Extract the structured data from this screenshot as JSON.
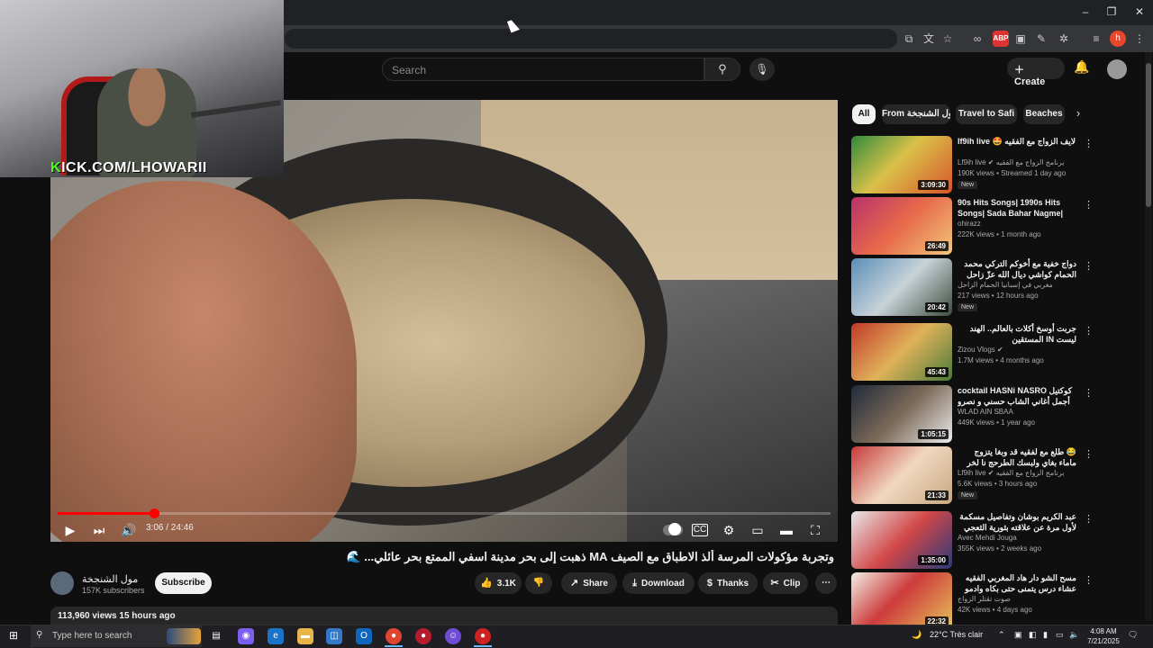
{
  "youtube": {
    "search_placeholder": "Search",
    "create_label": "Create"
  },
  "webcam": {
    "overlay_text_prefix": "K",
    "overlay_text": "KICK.COM/LHOWARII"
  },
  "player": {
    "time": "3:06 / 24:46",
    "progress": 0.125
  },
  "video": {
    "title": "وتجربة مؤكولات المرسة ألذ الاطباق مع الصيف MA ذهبت إلى بحر مدينة اسفي الممتع بحر عائلي... 🌊",
    "channel_name": "مول الشنجخة",
    "subscribers": "157K subscribers",
    "subscribe_label": "Subscribe",
    "likes": "3.1K",
    "share_label": "Share",
    "download_label": "Download",
    "thanks_label": "Thanks",
    "clip_label": "Clip",
    "views_date": "113,960 views  15 hours ago"
  },
  "chips": [
    {
      "label": "All"
    },
    {
      "label": "From مول الشنجخة"
    },
    {
      "label": "Travel to Safi"
    },
    {
      "label": "Beaches"
    }
  ],
  "sidebar": [
    {
      "title": "lf9ih live 🤩 لايف الزواج مع الفقيه",
      "channel": "Lf9ih live ✔ برنامج الزواج مع الفقيه",
      "meta": "190K views • Streamed 1 day ago",
      "badge": "New",
      "duration": "3:09:30",
      "rtl": false
    },
    {
      "title": "90s Hits Songs| 1990s Hits Songs| Sada Bahar Nagme| Sr...",
      "channel": "ohirazz",
      "meta": "222K views • 1 month ago",
      "badge": "",
      "duration": "26:49",
      "rtl": false
    },
    {
      "title": "دواج خفية مع أخوكم التركي محمد الحمام كواشي ديال الله عزّ زاحل في إسبانيا 😂 ...",
      "channel": "مغربي في إسبانيا الحمام الزاحل",
      "meta": "217 views • 12 hours ago",
      "badge": "New",
      "duration": "20:42",
      "rtl": true
    },
    {
      "title": "جربت أوسخ أكلات بالعالم.. الهند ليست IN المستقين",
      "channel": "Zizou Vlogs ✔",
      "meta": "1.7M views • 4 months ago",
      "badge": "",
      "duration": "45:43",
      "rtl": true
    },
    {
      "title": "cocktail HASNi NASRO كوكتيل أجمل أغاني الشاب حسني و نصرو",
      "channel": "WLAD AIN SBAA",
      "meta": "449K views • 1 year ago",
      "badge": "",
      "duration": "1:05:15",
      "rtl": false
    },
    {
      "title": "😂 طلع مع لفقيه قد وبغا يتزوج ماماء بغاي ولبسك الطرحج نا لخر",
      "channel": "Lf9ih live ✔ برنامج الزواج مع الفقيه",
      "meta": "5.6K views • 3 hours ago",
      "badge": "New",
      "duration": "21:33",
      "rtl": true
    },
    {
      "title": "عبد الكريم بوشان وتفاصيل مسكمة لأول مرة عن علاقته بثورية الثعجي وكيف قتل من",
      "channel": "Avec Mehdi Jouga",
      "meta": "355K views • 2 weeks ago",
      "badge": "",
      "duration": "1:35:00",
      "rtl": true
    },
    {
      "title": "مسح الشو دار هاد المغربي الفقيه عشاء درس يتمنى حتى بكاه وادمو هاد الحلقة راه رائف",
      "channel": "صوت تقتلر الزواج",
      "meta": "42K views • 4 days ago",
      "badge": "",
      "duration": "22:32",
      "rtl": true
    }
  ],
  "taskbar": {
    "search_placeholder": "Type here to search",
    "weather": "22°C  Très clair",
    "time": "4:08 AM",
    "date": "7/21/2025"
  }
}
